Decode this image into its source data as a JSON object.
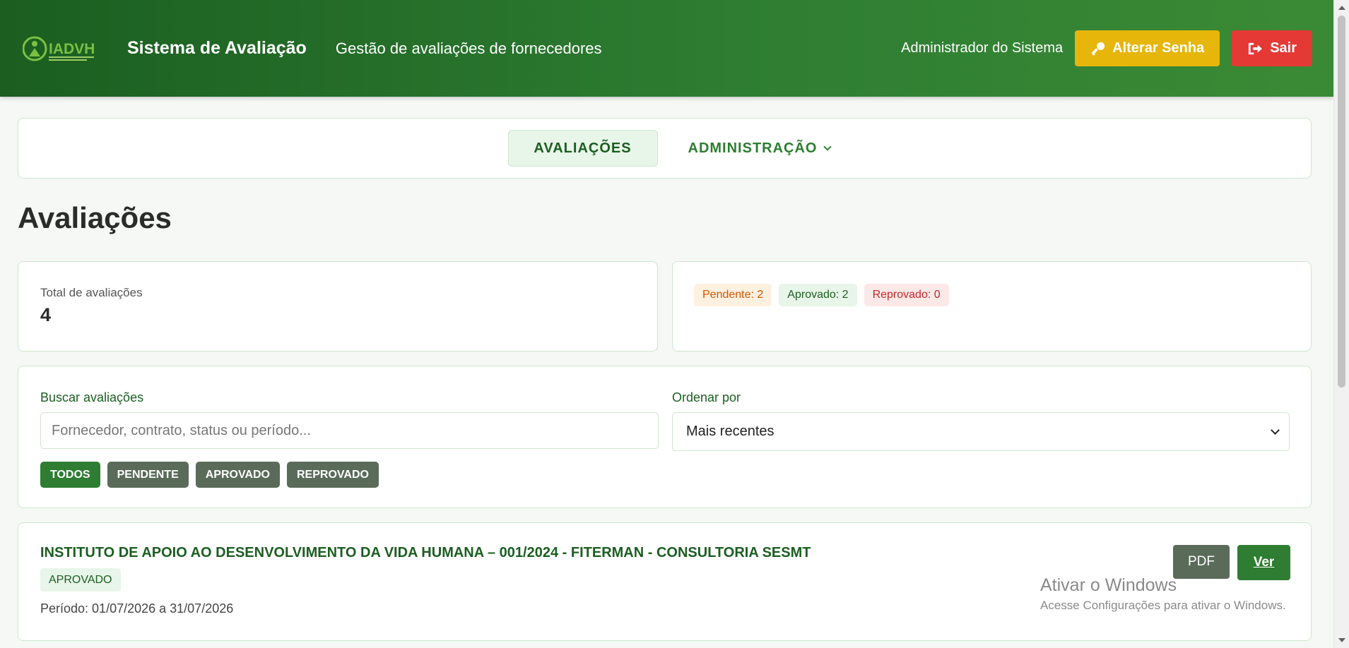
{
  "header": {
    "logo_text": "IADVH",
    "title": "Sistema de Avaliação",
    "subtitle": "Gestão de avaliações de fornecedores",
    "user_name": "Administrador do Sistema",
    "change_password_label": "Alterar Senha",
    "logout_label": "Sair"
  },
  "nav": {
    "tabs": [
      {
        "label": "AVALIAÇÕES",
        "active": true
      },
      {
        "label": "ADMINISTRAÇÃO",
        "active": false
      }
    ]
  },
  "page": {
    "title": "Avaliações"
  },
  "summary": {
    "total_label": "Total de avaliações",
    "total_value": "4",
    "badges": [
      "Pendente: 2",
      "Aprovado: 2",
      "Reprovado: 0"
    ]
  },
  "filters": {
    "search_label": "Buscar avaliações",
    "search_placeholder": "Fornecedor, contrato, status ou período...",
    "sort_label": "Ordenar por",
    "sort_value": "Mais recentes",
    "chips": [
      {
        "label": "TODOS",
        "active": true
      },
      {
        "label": "PENDENTE",
        "active": false
      },
      {
        "label": "APROVADO",
        "active": false
      },
      {
        "label": "REPROVADO",
        "active": false
      }
    ]
  },
  "items": [
    {
      "title": "INSTITUTO DE APOIO AO DESENVOLVIMENTO DA VIDA HUMANA – 001/2024 - FITERMAN - CONSULTORIA SESMT",
      "status": "APROVADO",
      "period": "Período: 01/07/2026 a 31/07/2026",
      "pdf_label": "PDF",
      "view_label": "Ver"
    }
  ],
  "watermark": {
    "title": "Ativar o Windows",
    "subtitle": "Acesse Configurações para ativar o Windows."
  },
  "colors": {
    "brand_green": "#2e7d32",
    "dark_green": "#1b5e20",
    "warning": "#e6b60a",
    "danger": "#e53935"
  },
  "icons": [
    "key-icon",
    "logout-icon",
    "chevron-down-icon"
  ]
}
